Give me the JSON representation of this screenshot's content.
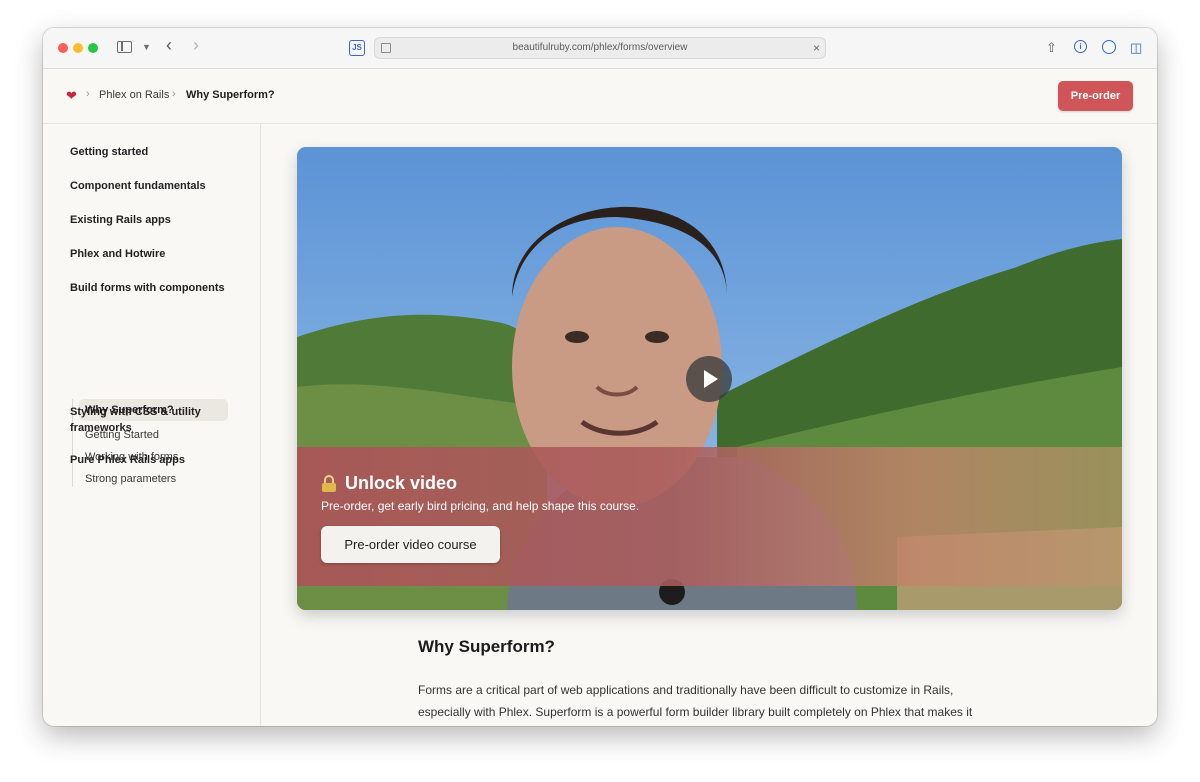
{
  "browser": {
    "url": "beautifulruby.com/phlex/forms/overview",
    "extension_badge": "JS",
    "info_icon_glyph": "i"
  },
  "breadcrumb": {
    "home_icon": "heart-icon",
    "parent": "Phlex on Rails",
    "current": "Why Superform?"
  },
  "header": {
    "preorder_label": "Pre-order",
    "accent_color": "#d05558"
  },
  "sidebar": {
    "items": [
      "Getting started",
      "Component fundamentals",
      "Existing Rails apps",
      "Phlex and Hotwire",
      "Build forms with components",
      "Styling with CSS & utility frameworks",
      "Pure Phlex Rails apps"
    ],
    "subitems": [
      "Why Superform?",
      "Getting Started",
      "Working with forms",
      "Strong parameters"
    ],
    "active_subitem": "Why Superform?"
  },
  "video": {
    "lock_icon": "lock-icon",
    "unlock_title": "Unlock video",
    "unlock_subtitle": "Pre-order, get early bird pricing, and help shape this course.",
    "unlock_button": "Pre-order video course"
  },
  "article": {
    "title": "Why Superform?",
    "body": "Forms are a critical part of web applications and traditionally have been difficult to customize in Rails, especially with Phlex. Superform is a powerful form builder library built completely on Phlex that makes it"
  }
}
